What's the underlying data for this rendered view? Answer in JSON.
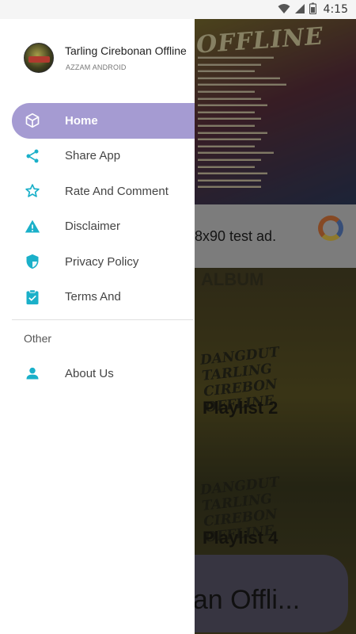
{
  "status_bar": {
    "time": "4:15"
  },
  "drawer": {
    "header": {
      "title": "Tarling Cirebonan Offline",
      "subtitle": "AZZAM ANDROID"
    },
    "items": [
      {
        "label": "Home",
        "icon": "cube-icon",
        "active": true
      },
      {
        "label": "Share App",
        "icon": "share-icon",
        "active": false
      },
      {
        "label": "Rate And Comment",
        "icon": "star-outline-icon",
        "active": false
      },
      {
        "label": "Disclaimer",
        "icon": "warning-icon",
        "active": false
      },
      {
        "label": "Privacy Policy",
        "icon": "shield-check-icon",
        "active": false
      },
      {
        "label": "Terms And",
        "icon": "clipboard-check-icon",
        "active": false
      }
    ],
    "section_label": "Other",
    "other_items": [
      {
        "label": "About Us",
        "icon": "person-icon"
      }
    ],
    "accent_color": "#a59bd2",
    "icon_color": "#00bcd4"
  },
  "background": {
    "banner_title": "OFFLINE",
    "ad_text": "8x90 test ad.",
    "album_heading": "ALBUM",
    "playlist_2": "Playlist 2",
    "playlist_4": "Playlist 4",
    "art_text_1": "DANGDUT TARLING CIREBON OFFLINE",
    "art_text_2": "DANGDUT TARLING CIREBON OFFLINE",
    "pill_text": "onan Offli..."
  }
}
